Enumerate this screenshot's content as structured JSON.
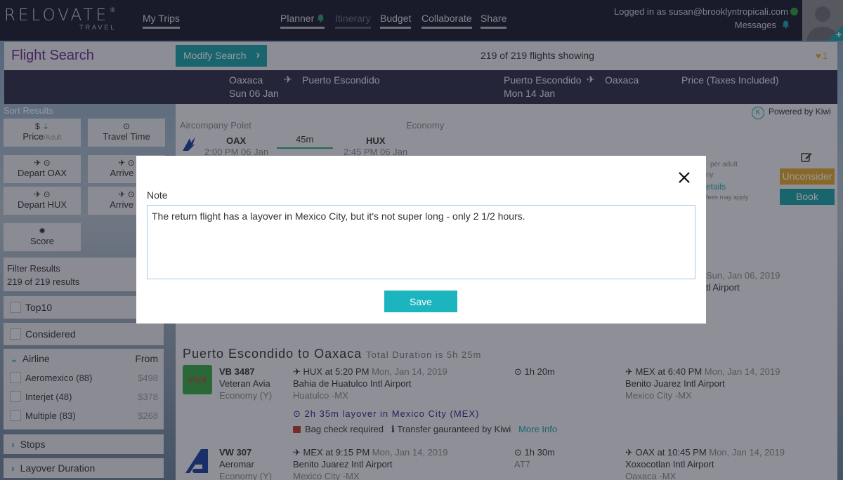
{
  "nav": {
    "brand": "RELOVATE",
    "brand_sub": "TRAVEL",
    "reg": "®",
    "links": [
      {
        "label": "My Trips",
        "active": true
      },
      {
        "label": "Planner",
        "active": true
      },
      {
        "label": "Itinerary",
        "active": false
      },
      {
        "label": "Budget",
        "active": true
      },
      {
        "label": "Collaborate",
        "active": true
      },
      {
        "label": "Share",
        "active": true
      }
    ],
    "login_text": "Logged in as susan@brooklyntropicali.com",
    "messages_label": "Messages",
    "colors": {
      "bg": "#1c1d2c",
      "accent": "#1aa3a8",
      "bell": "#2e9a6a",
      "online": "#2e9a3a"
    }
  },
  "header": {
    "title": "Flight Search",
    "modify_label": "Modify Search",
    "showing": "219 of 219 flights showing",
    "favorites_count": "1"
  },
  "route": {
    "outbound": {
      "from": "Oaxaca",
      "to": "Puerto Escondido",
      "date": "Sun 06 Jan"
    },
    "return": {
      "from": "Puerto Escondido",
      "to": "Oaxaca",
      "date": "Mon 14 Jan"
    },
    "price_header": "Price (Taxes Included)"
  },
  "sidebar": {
    "sort_title": "Sort Results",
    "sort_buttons": [
      {
        "label": "Price",
        "sub": "/Adult",
        "icon": "dollar-sort-icon"
      },
      {
        "label": "Travel Time",
        "icon": "clock-icon"
      },
      {
        "label": "Depart OAX",
        "icon": "takeoff-clock-icon"
      },
      {
        "label": "Arrive H",
        "icon": "landing-clock-icon"
      },
      {
        "label": "Depart HUX",
        "icon": "takeoff-clock-icon"
      },
      {
        "label": "Arrive O",
        "icon": "landing-clock-icon"
      },
      {
        "label": "Score",
        "icon": "badge-icon"
      }
    ],
    "filter_title": "Filter Results",
    "filter_count": "219 of 219 results",
    "top10": "Top10",
    "considered": "Considered",
    "airline_label": "Airline",
    "from_label": "From",
    "airlines": [
      {
        "name": "Aeromexico (88)",
        "price": "$498"
      },
      {
        "name": "Interjet (48)",
        "price": "$378"
      },
      {
        "name": "Multiple (83)",
        "price": "$268"
      }
    ],
    "stops_label": "Stops",
    "layover_label": "Layover Duration"
  },
  "results": {
    "powered_by": "Powered by Kiwi",
    "first": {
      "airline": "Aircompany Polet",
      "cabin": "Economy",
      "from_code": "OAX",
      "from_time": "2:00 PM 06 Jan",
      "duration": "45m",
      "to_code": "HUX",
      "to_time": "2:45 PM 06 Jan",
      "per_adult": "per adult",
      "details": "etails",
      "fees": "fees may apply",
      "partial_ny": "ny",
      "unconsider": "Unconsider",
      "book": "Book",
      "arrival_date_partial": "Sun, Jan 06, 2019",
      "arrival_airport_partial": "tl Airport"
    },
    "return_section": {
      "title": "Puerto Escondido to Oaxaca",
      "total": "Total Duration is 5h 25m",
      "legs": [
        {
          "flight": "VB 3487",
          "carrier": "Veteran Avia",
          "cabin": "Economy (Y)",
          "logo_text": "viva",
          "depart": "HUX at 5:20 PM",
          "depart_date": "Mon, Jan 14, 2019",
          "depart_airport": "Bahia de Huatulco Intl Airport",
          "depart_city": "Huatulco -MX",
          "duration": "1h 20m",
          "aircraft": "",
          "arrive": "MEX at 6:40 PM",
          "arrive_date": "Mon, Jan 14, 2019",
          "arrive_airport": "Benito Juarez Intl Airport",
          "arrive_city": "Mexico City -MX"
        },
        {
          "flight": "VW 307",
          "carrier": "Aeromar",
          "cabin": "Economy (Y)",
          "logo_text": "",
          "depart": "MEX at 9:15 PM",
          "depart_date": "Mon, Jan 14, 2019",
          "depart_airport": "Benito Juarez Intl Airport",
          "depart_city": "Mexico City -MX",
          "duration": "1h 30m",
          "aircraft": "AT7",
          "arrive": "OAX at 10:45 PM",
          "arrive_date": "Mon, Jan 14, 2019",
          "arrive_airport": "Xoxocotlan Intl Airport",
          "arrive_city": "Oaxaca -MX"
        }
      ],
      "layover": "2h 35m layover in Mexico City (MEX)",
      "bag_check": "Bag check required",
      "transfer": "Transfer gauranteed by Kiwi",
      "more_info": "More Info"
    }
  },
  "modal": {
    "label": "Note",
    "note_value": "The return flight has a layover in Mexico City, but it's not super long - only 2 1/2 hours.",
    "save_label": "Save",
    "colors": {
      "save": "#1bb4bf",
      "border": "#a9c8e8"
    }
  }
}
